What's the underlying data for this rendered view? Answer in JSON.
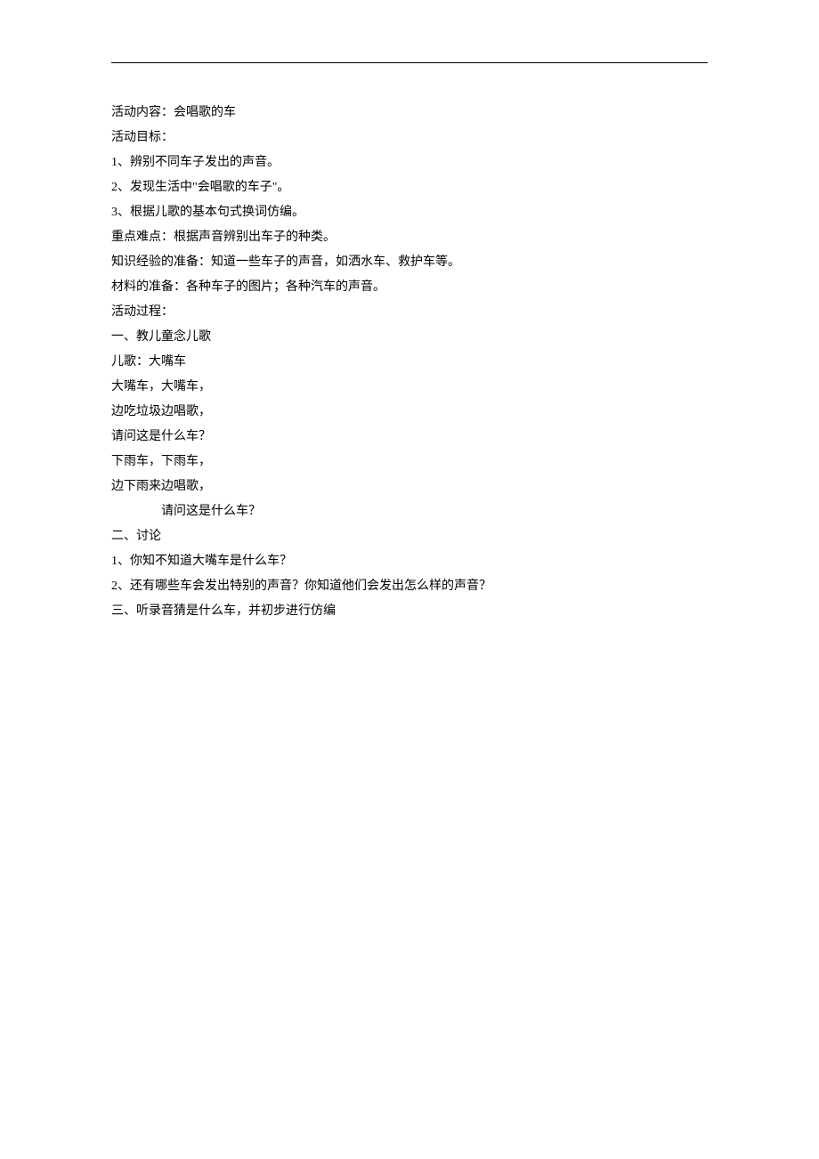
{
  "lines": [
    {
      "text": "活动内容：会唱歌的车",
      "indent": false
    },
    {
      "text": "活动目标：",
      "indent": false
    },
    {
      "text": "1、辨别不同车子发出的声音。",
      "indent": false
    },
    {
      "text": "2、发现生活中\"会唱歌的车子\"。",
      "indent": false
    },
    {
      "text": "3、根据儿歌的基本句式换词仿编。",
      "indent": false
    },
    {
      "text": "重点难点：根据声音辨别出车子的种类。",
      "indent": false
    },
    {
      "text": "知识经验的准备：知道一些车子的声音，如洒水车、救护车等。",
      "indent": false
    },
    {
      "text": "材料的准备：各种车子的图片；各种汽车的声音。",
      "indent": false
    },
    {
      "text": "活动过程：",
      "indent": false
    },
    {
      "text": "一、教儿童念儿歌",
      "indent": false
    },
    {
      "text": "儿歌：大嘴车",
      "indent": false
    },
    {
      "text": "大嘴车，大嘴车，",
      "indent": false
    },
    {
      "text": "边吃垃圾边唱歌，",
      "indent": false
    },
    {
      "text": "请问这是什么车？",
      "indent": false
    },
    {
      "text": "下雨车，下雨车，",
      "indent": false
    },
    {
      "text": "边下雨来边唱歌，",
      "indent": false
    },
    {
      "text": "请问这是什么车？",
      "indent": true
    },
    {
      "text": "二、讨论",
      "indent": false
    },
    {
      "text": "1、你知不知道大嘴车是什么车？",
      "indent": false
    },
    {
      "text": "2、还有哪些车会发出特别的声音？你知道他们会发出怎么样的声音？",
      "indent": false
    },
    {
      "text": "三、听录音猜是什么车，并初步进行仿编",
      "indent": false
    }
  ]
}
